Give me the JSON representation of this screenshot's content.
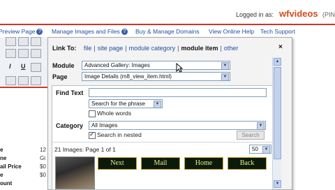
{
  "header": {
    "logged_in_label": "Logged in as:",
    "brand": "wfvideos",
    "pin_text": "(PIN"
  },
  "nav": {
    "items": [
      {
        "label": "Preview Page",
        "help": "?"
      },
      {
        "label": "Manage Images and Files",
        "help": "?"
      },
      {
        "label": "Buy & Manage Domains"
      },
      {
        "label": "View Online Help"
      },
      {
        "label": "Tech Support"
      }
    ]
  },
  "editor_toolbar": {
    "italic": "I",
    "underline": "U"
  },
  "product_fields": [
    {
      "label": "e",
      "value": "12"
    },
    {
      "label": "ne",
      "value": "Gi"
    },
    {
      "label": "ail Price",
      "value": "$0"
    },
    {
      "label": "e",
      "value": "$0"
    },
    {
      "label": "ount",
      "value": ""
    }
  ],
  "dialog": {
    "link_to_label": "Link To:",
    "link_types": [
      "file",
      "site page",
      "module category",
      "module item",
      "other"
    ],
    "active_link_type": "module item",
    "close": "×",
    "module": {
      "label": "Module",
      "value": "Advanced Gallery: Images"
    },
    "page": {
      "label": "Page",
      "value": "Image Details (m8_view_item.html)"
    },
    "find_text": {
      "label": "Find Text",
      "value": ""
    },
    "search_mode": "Search for the phrase",
    "whole_words": {
      "label": "Whole words",
      "checked": false
    },
    "category": {
      "label": "Category",
      "value": "All Images"
    },
    "search_nested": {
      "label": "Search in nested",
      "checked": true
    },
    "search_button": "Search",
    "results_summary": "21 Images: Page 1 of 1",
    "per_page": "50",
    "buttons": [
      "Next",
      "Mail",
      "Home",
      "Back"
    ]
  },
  "colors": {
    "accent_red": "#c9382a",
    "link_blue": "#1f4e9c",
    "brand_orange": "#d44a1c",
    "button_bg": "#0b1b0b",
    "button_text": "#e8ef8a"
  }
}
